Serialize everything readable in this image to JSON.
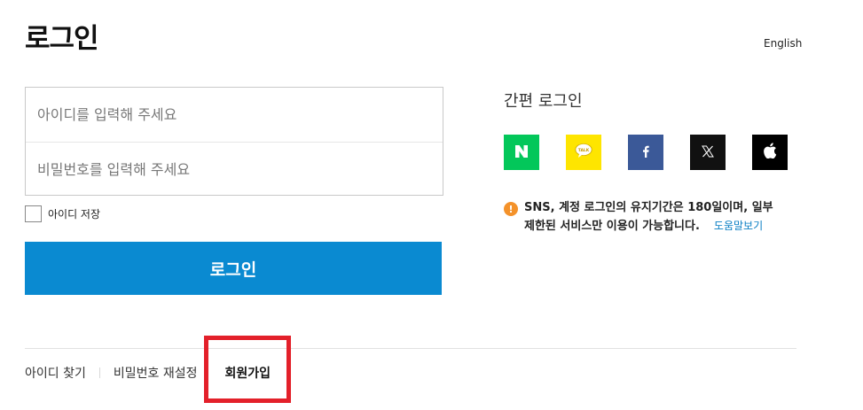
{
  "header": {
    "title": "로그인",
    "lang_link": "English"
  },
  "form": {
    "id_placeholder": "아이디를 입력해 주세요",
    "pw_placeholder": "비밀번호를 입력해 주세요",
    "save_id_label": "아이디 저장",
    "login_button": "로그인"
  },
  "sns": {
    "title": "간편 로그인",
    "providers": [
      {
        "name": "naver",
        "icon": "naver-icon",
        "color": "#03c75a"
      },
      {
        "name": "kakao",
        "icon": "kakao-talk-icon",
        "color": "#fee500",
        "icon_text": "TALK"
      },
      {
        "name": "facebook",
        "icon": "facebook-icon",
        "color": "#3b5998"
      },
      {
        "name": "x",
        "icon": "x-icon",
        "color": "#111111"
      },
      {
        "name": "apple",
        "icon": "apple-icon",
        "color": "#000000"
      }
    ],
    "notice_line1": "SNS, 계정 로그인의 유지기간은 180일이며, 일부",
    "notice_line2": "제한된 서비스만 이용이 가능합니다.",
    "help_link": "도움말보기"
  },
  "bottom": {
    "find_id": "아이디 찾기",
    "reset_pw": "비밀번호 재설정",
    "signup": "회원가입"
  },
  "colors": {
    "accent": "#0a8ad1",
    "highlight": "#e3202a",
    "info": "#f4922a"
  }
}
